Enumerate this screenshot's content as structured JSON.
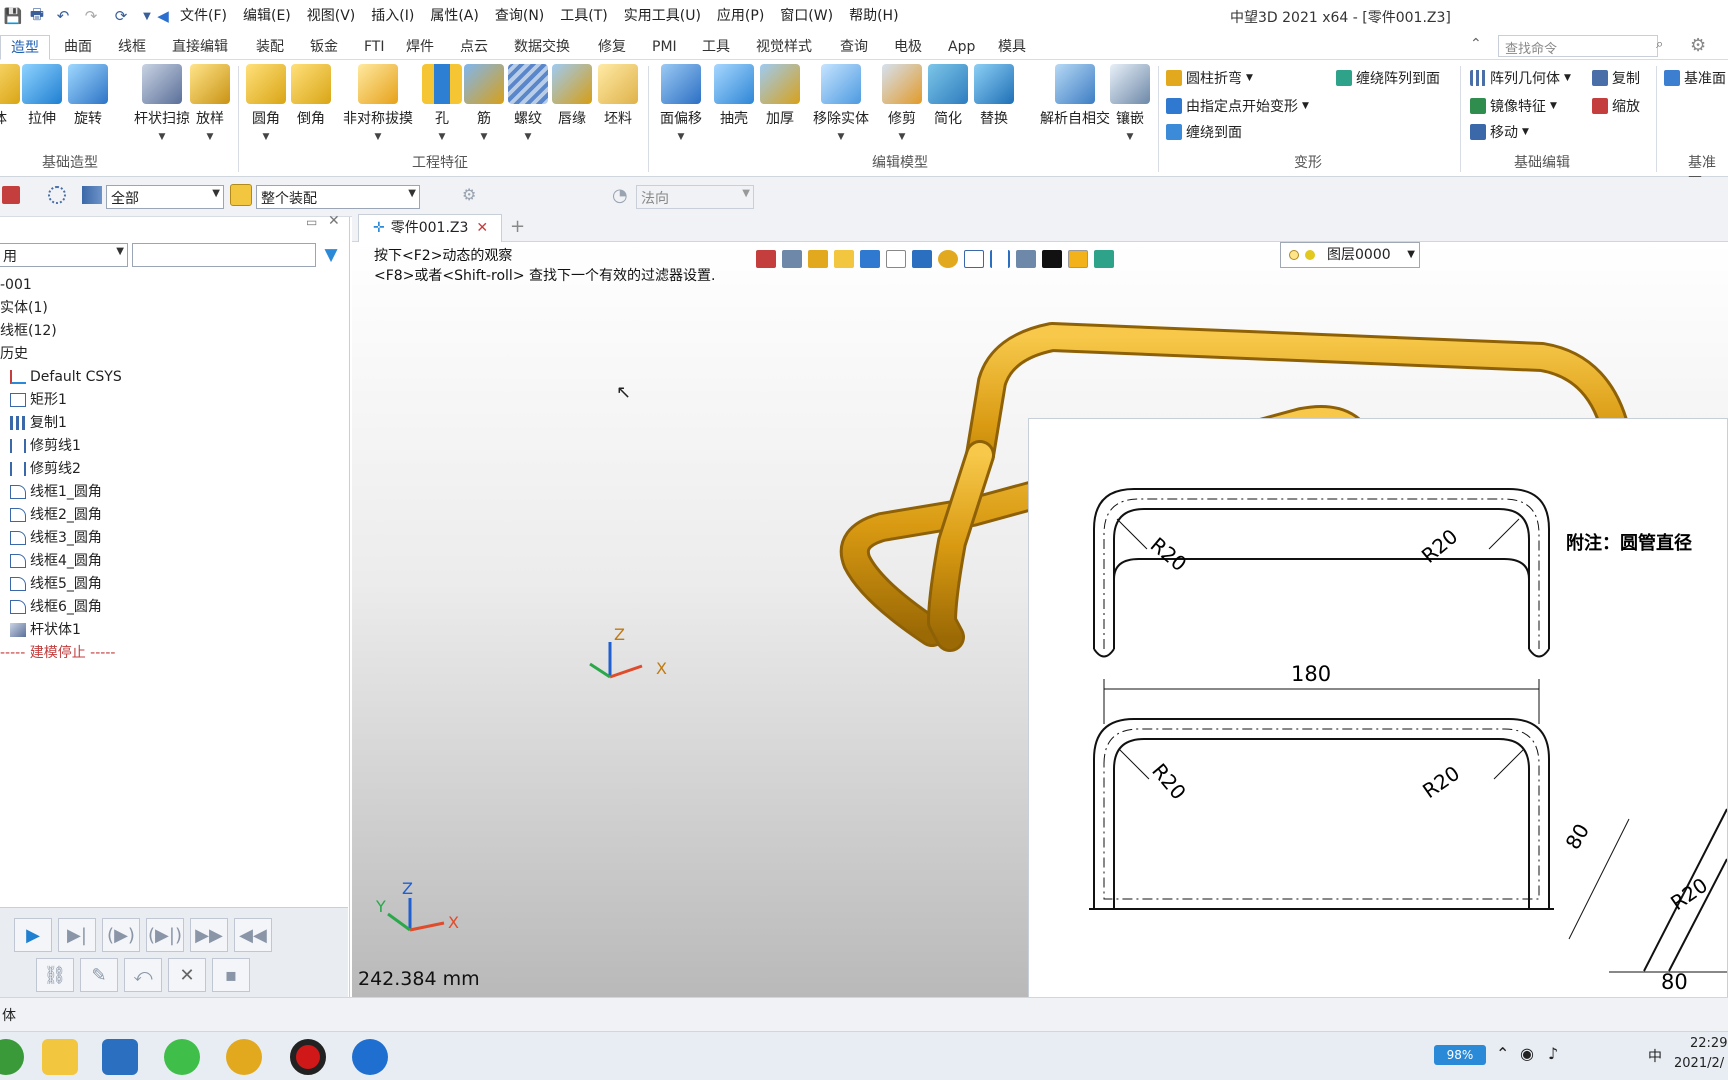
{
  "app": {
    "title": "中望3D 2021 x64 - [零件001.Z3]"
  },
  "menu": [
    "文件(F)",
    "编辑(E)",
    "视图(V)",
    "插入(I)",
    "属性(A)",
    "查询(N)",
    "工具(T)",
    "实用工具(U)",
    "应用(P)",
    "窗口(W)",
    "帮助(H)"
  ],
  "ribbon_tabs": [
    "造型",
    "曲面",
    "线框",
    "直接编辑",
    "装配",
    "钣金",
    "FTI",
    "焊件",
    "点云",
    "数据交换",
    "修复",
    "PMI",
    "工具",
    "视觉样式",
    "查询",
    "电极",
    "App",
    "模具"
  ],
  "search_placeholder": "查找命令",
  "ribbon": {
    "g1": {
      "label": "基础造型",
      "btns": [
        "体",
        "拉伸",
        "旋转",
        "杆状扫掠",
        "放样"
      ]
    },
    "g2": {
      "label": "工程特征",
      "btns": [
        "圆角",
        "倒角",
        "非对称拔摸",
        "孔",
        "筋",
        "螺纹",
        "唇缘",
        "坯料"
      ]
    },
    "g3": {
      "label": "编辑模型",
      "btns": [
        "面偏移",
        "抽壳",
        "加厚",
        "移除实体",
        "修剪",
        "简化",
        "替换",
        "解析自相交",
        "镶嵌"
      ]
    },
    "g4": {
      "label": "变形",
      "items": [
        "圆柱折弯",
        "由指定点开始变形",
        "缠绕到面",
        "缠绕阵列到面"
      ]
    },
    "g5": {
      "label": "基础编辑",
      "items": [
        "阵列几何体",
        "镜像特征",
        "移动",
        "复制",
        "缩放"
      ]
    },
    "g6": {
      "label": "基准面"
    }
  },
  "filterbar": {
    "filter1": "全部",
    "filter2": "整个装配",
    "filter3": "法向"
  },
  "tree": {
    "filter_value": "用",
    "rows": [
      "‑001",
      "实体(1)",
      "线框(12)",
      "历史",
      "Default CSYS",
      "矩形1",
      "复制1",
      "修剪线1",
      "修剪线2",
      "线框1_圆角",
      "线框2_圆角",
      "线框3_圆角",
      "线框4_圆角",
      "线框5_圆角",
      "线框6_圆角",
      "杆状体1",
      "----- 建模停止 -----"
    ]
  },
  "doc_tab": "零件001.Z3",
  "viewport": {
    "hint1": "按下<F2>动态的观察",
    "hint2": "<F8>或者<Shift-roll> 查找下一个有效的过滤器设置.",
    "layer": "图层0000",
    "distance": "242.384 mm",
    "axis_labels": {
      "x": "X",
      "y": "Y",
      "z": "Z"
    }
  },
  "drawing": {
    "note": "附注：圆管直径",
    "dims": {
      "top_left": "R20",
      "top_right": "R20",
      "width": "180",
      "bottom_left": "R20",
      "bottom_right": "R20",
      "side_len": "80",
      "side_r": "R20",
      "side_base": "80"
    }
  },
  "statusbar": {
    "text": "体"
  },
  "taskbar": {
    "battery": "98%",
    "time": "22:29",
    "date": "2021/2/",
    "ime": "中"
  },
  "colors": {
    "pipe": "#e0a317",
    "accent": "#1f5fb0"
  }
}
